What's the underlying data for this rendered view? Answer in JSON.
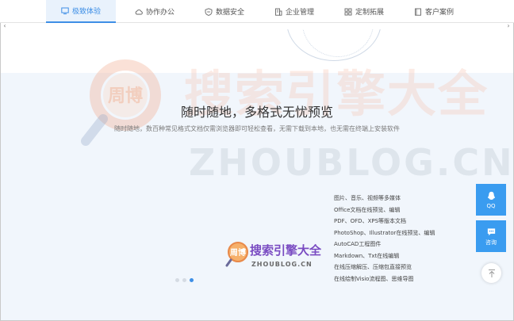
{
  "tabs": [
    {
      "label": "极致体验",
      "icon": "monitor-icon",
      "active": true
    },
    {
      "label": "协作办公",
      "icon": "cloud-icon",
      "active": false
    },
    {
      "label": "数据安全",
      "icon": "shield-icon",
      "active": false
    },
    {
      "label": "企业管理",
      "icon": "building-icon",
      "active": false
    },
    {
      "label": "定制拓展",
      "icon": "grid-icon",
      "active": false
    },
    {
      "label": "客户案例",
      "icon": "document-icon",
      "active": false
    }
  ],
  "carousel": {
    "prev_arrow": "‹",
    "next_arrow": "›",
    "headline": "随时随地，多格式无忧预览",
    "subline": "随时随地，数百种常见格式文档仅需浏览器即可轻松查看，无需下载到本地，也无需在终端上安装软件",
    "features": [
      "图片、音乐、视频等多媒体",
      "Office文档在线预览、编辑",
      "PDF、OFD、XPS等版本文档",
      "PhotoShop、Illustrator在线预览、编辑",
      "AutoCAD工程图件",
      "Markdown、Txt在线编辑",
      "在线压缩解压、压缩包直接预览",
      "在线绘制Visio流程图、思维导图"
    ],
    "dots": [
      {
        "active": false
      },
      {
        "active": false
      },
      {
        "active": true
      }
    ]
  },
  "watermark": {
    "cn": "搜索引擎大全",
    "en": "ZHOUBLOG.CN",
    "logo_text": "周博"
  },
  "mini_logo": {
    "title": "搜索引擎大全",
    "sub": "ZHOUBLOG.CN",
    "logo_text": "周博"
  },
  "side": {
    "qq_label": "QQ",
    "consult_label": "咨询"
  },
  "colors": {
    "accent": "#3e8fe6",
    "side_bg": "#3a9cf0",
    "main_bg": "#f1f6fc"
  }
}
